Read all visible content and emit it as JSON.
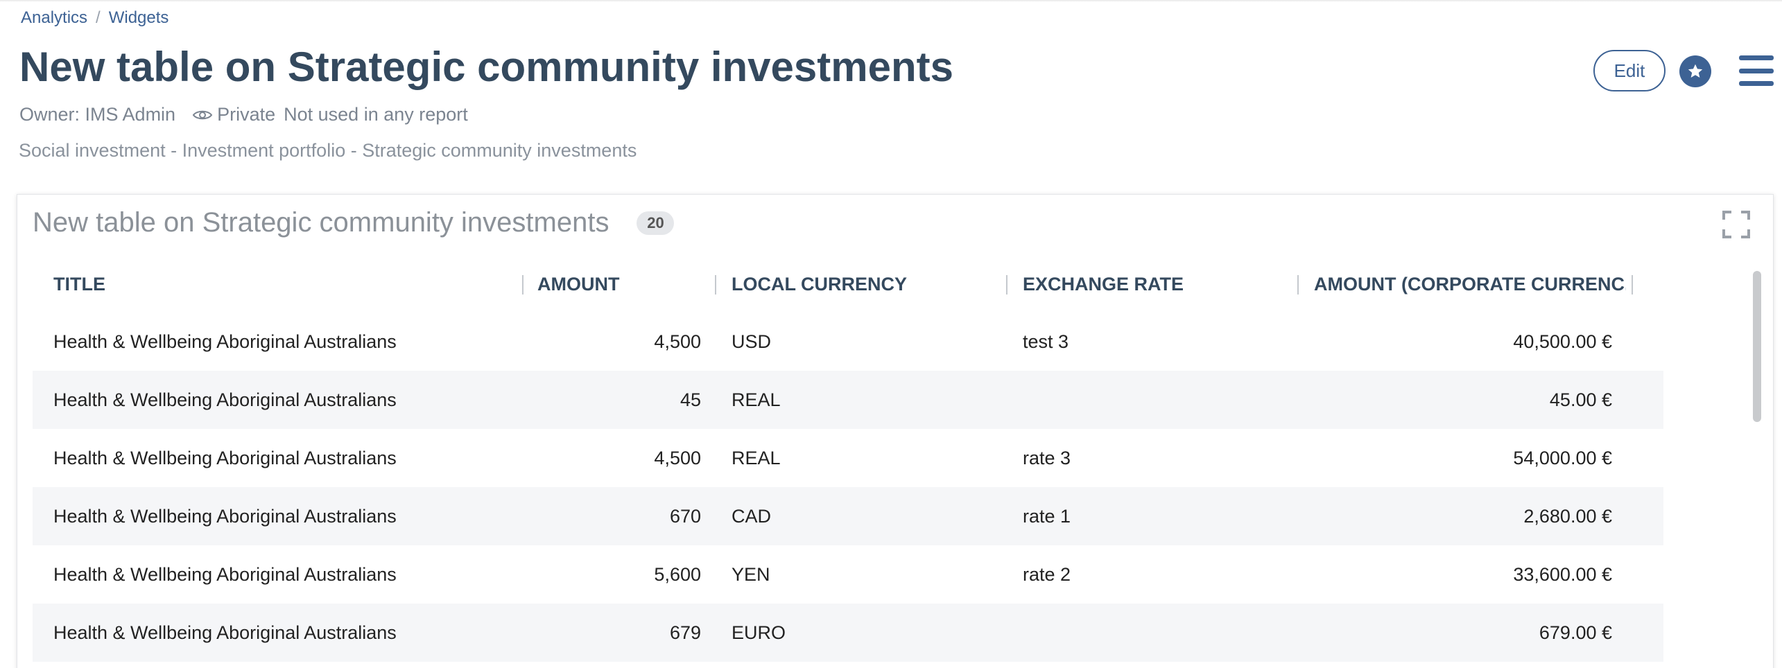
{
  "breadcrumb": {
    "items": [
      "Analytics",
      "Widgets"
    ],
    "separator": "/"
  },
  "header": {
    "title": "New table on Strategic community investments",
    "owner": "Owner: IMS Admin",
    "visibility": "Private",
    "usage": "Not used in any report",
    "path": "Social investment - Investment portfolio - Strategic community investments",
    "edit_label": "Edit",
    "icons": {
      "visibility": "eye-icon",
      "favorite": "star-icon",
      "menu": "hamburger-menu-icon"
    }
  },
  "widget": {
    "title": "New table on Strategic community investments",
    "count": "20",
    "expand_icon": "fullscreen-icon",
    "columns": [
      "TITLE",
      "AMOUNT",
      "LOCAL CURRENCY",
      "EXCHANGE RATE",
      "AMOUNT (CORPORATE CURRENC..."
    ],
    "rows": [
      {
        "title": "Health & Wellbeing Aboriginal Australians",
        "amount": "4,500",
        "currency": "USD",
        "rate": "test 3",
        "corporate": "40,500.00 €"
      },
      {
        "title": "Health & Wellbeing Aboriginal Australians",
        "amount": "45",
        "currency": "REAL",
        "rate": "",
        "corporate": "45.00 €"
      },
      {
        "title": "Health & Wellbeing Aboriginal Australians",
        "amount": "4,500",
        "currency": "REAL",
        "rate": "rate 3",
        "corporate": "54,000.00 €"
      },
      {
        "title": "Health & Wellbeing Aboriginal Australians",
        "amount": "670",
        "currency": "CAD",
        "rate": "rate 1",
        "corporate": "2,680.00 €"
      },
      {
        "title": "Health & Wellbeing Aboriginal Australians",
        "amount": "5,600",
        "currency": "YEN",
        "rate": "rate 2",
        "corporate": "33,600.00 €"
      },
      {
        "title": "Health & Wellbeing Aboriginal Australians",
        "amount": "679",
        "currency": "EURO",
        "rate": "",
        "corporate": "679.00 €"
      }
    ]
  },
  "colors": {
    "accent": "#3d6294",
    "heading": "#34495e",
    "row_alt": "#f5f6f8"
  }
}
